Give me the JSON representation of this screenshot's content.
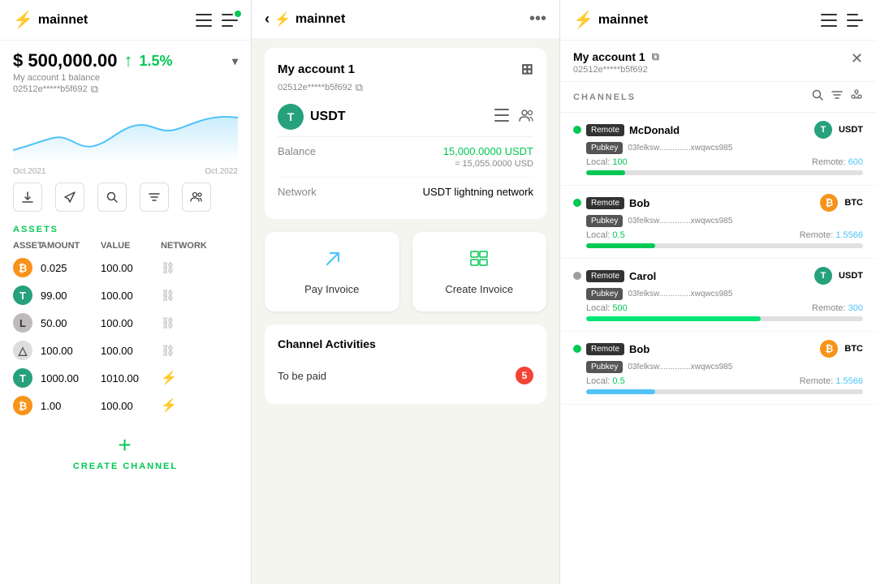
{
  "left": {
    "brand": "mainnet",
    "balance": "$ 500,000.00",
    "change": "1.5%",
    "account_label": "My account 1 balance",
    "address": "02512e*****b5f692",
    "chart_label_start": "Oct.2021",
    "chart_label_end": "Oct.2022",
    "section_assets": "ASSETS",
    "table_headers": [
      "ASSET",
      "AMOUNT",
      "VALUE",
      "NETWORK"
    ],
    "assets": [
      {
        "icon": "BTC",
        "type": "btc",
        "amount": "0.025",
        "value": "100.00",
        "network": "link"
      },
      {
        "icon": "T",
        "type": "usdt",
        "amount": "99.00",
        "value": "100.00",
        "network": "link"
      },
      {
        "icon": "L",
        "type": "ltc",
        "amount": "50.00",
        "value": "100.00",
        "network": "link"
      },
      {
        "icon": "△",
        "type": "aleph",
        "amount": "100.00",
        "value": "100.00",
        "network": "link"
      },
      {
        "icon": "T",
        "type": "usdt",
        "amount": "1000.00",
        "value": "1010.00",
        "network": "lightning"
      },
      {
        "icon": "B",
        "type": "btc",
        "amount": "1.00",
        "value": "100.00",
        "network": "lightning"
      }
    ],
    "create_channel": "CREATE CHANNEL"
  },
  "middle": {
    "brand": "mainnet",
    "account_name": "My account 1",
    "address": "02512e*****b5f692",
    "token": "USDT",
    "balance_usdt": "15,000.0000 USDT",
    "balance_usd": "= 15,055.0000 USD",
    "network_label": "Network",
    "network_value": "USDT lightning network",
    "balance_label": "Balance",
    "pay_invoice": "Pay Invoice",
    "create_invoice": "Create Invoice",
    "channel_activities": "Channel Activities",
    "to_be_paid": "To be paid",
    "to_be_paid_count": "5"
  },
  "right": {
    "brand": "mainnet",
    "account_name": "My account 1",
    "address": "02512e*****b5f692",
    "channels_label": "CHANNELS",
    "channels": [
      {
        "status": "active",
        "name": "McDonald",
        "token": "USDT",
        "token_type": "usdt",
        "pubkey": "03felksw..............xwqwcs985",
        "local_label": "Local:",
        "local_val": "100",
        "remote_label": "Remote:",
        "remote_val": "600",
        "bar_local_pct": 14
      },
      {
        "status": "active",
        "name": "Bob",
        "token": "BTC",
        "token_type": "btc",
        "pubkey": "03felksw..............xwqwcs985",
        "local_label": "Local:",
        "local_val": "0.5",
        "remote_label": "Remote:",
        "remote_val": "1.5566",
        "bar_local_pct": 25
      },
      {
        "status": "inactive",
        "name": "Carol",
        "token": "USDT",
        "token_type": "usdt",
        "pubkey": "03felksw..............xwqwcs985",
        "local_label": "Local:",
        "local_val": "500",
        "remote_label": "Remote:",
        "remote_val": "300",
        "bar_local_pct": 63
      },
      {
        "status": "active",
        "name": "Bob",
        "token": "BTC",
        "token_type": "btc",
        "pubkey": "03felksw..............xwqwcs985",
        "local_label": "Local:",
        "local_val": "0.5",
        "remote_label": "Remote:",
        "remote_val": "1.5566",
        "bar_local_pct": 25
      }
    ]
  }
}
